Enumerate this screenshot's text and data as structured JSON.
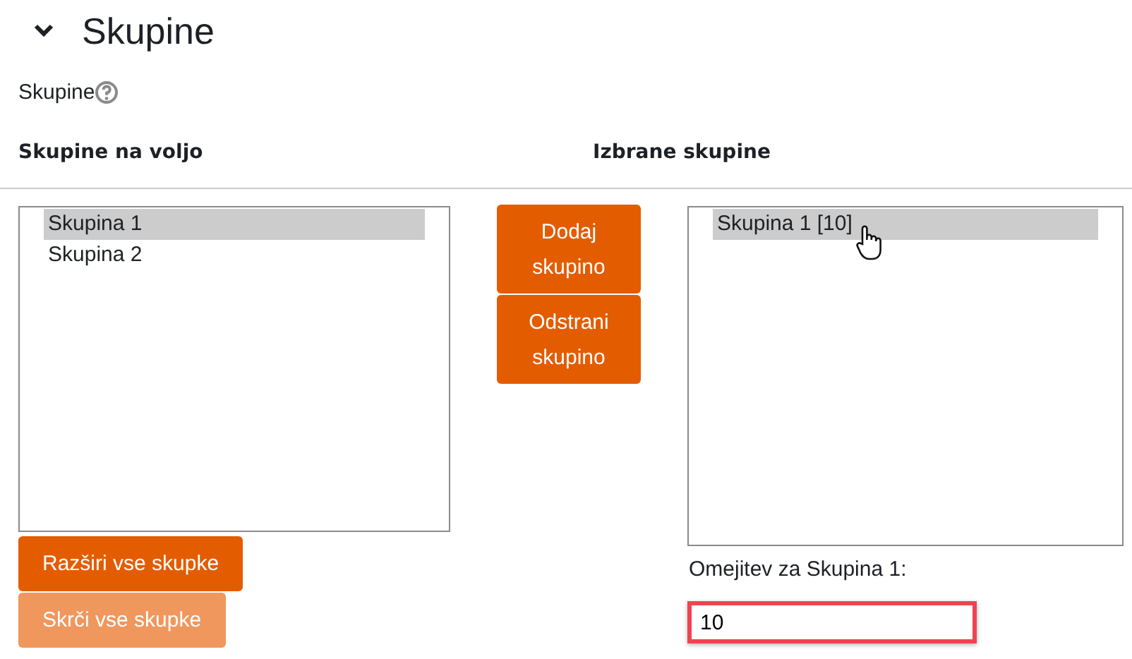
{
  "section": {
    "title": "Skupine",
    "expanded": true
  },
  "field_label": "Skupine",
  "available": {
    "heading": "Skupine na voljo",
    "items": [
      {
        "label": "Skupina 1",
        "selected": true
      },
      {
        "label": "Skupina 2",
        "selected": false
      }
    ]
  },
  "actions": [
    {
      "label": "Dodaj skupino"
    },
    {
      "label": "Odstrani skupino"
    }
  ],
  "chosen": {
    "heading": "Izbrane skupine",
    "items": [
      {
        "label": "Skupina 1 [10]",
        "selected": true
      }
    ]
  },
  "tree_buttons": [
    {
      "label": "Razširi vse skupke",
      "disabled": false
    },
    {
      "label": "Skrči vse skupke",
      "disabled": true
    }
  ],
  "limit": {
    "label": "Omejitev za Skupina 1:",
    "value": "10",
    "highlighted": true
  }
}
